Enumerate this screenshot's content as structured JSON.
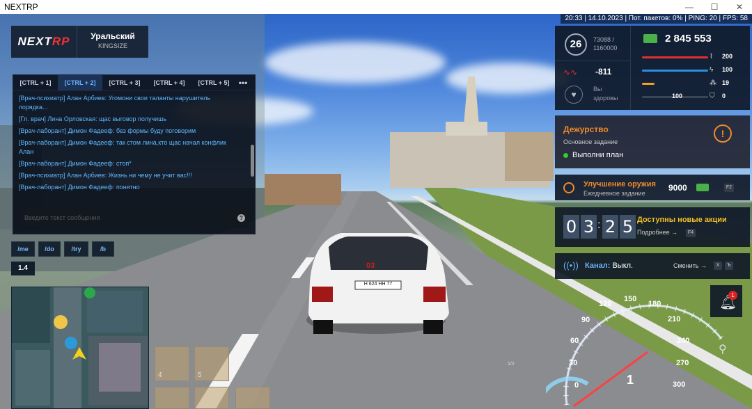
{
  "window": {
    "title": "NEXTRP",
    "min": "—",
    "max": "☐",
    "close": "✕"
  },
  "status": "20:33 | 14.10.2023 | Пот. пакетов: 0% | PING: 20 | FPS: 58",
  "logo": {
    "brand_a": "NEXT",
    "brand_b": "RP",
    "server": "Уральский",
    "sub": "KINGSIZE"
  },
  "chat": {
    "tabs": [
      "[CTRL + 1]",
      "[CTRL + 2]",
      "[CTRL + 3]",
      "[CTRL + 4]",
      "[CTRL + 5]",
      "•••"
    ],
    "messages": [
      "[Врач-психиатр] Алан Арбиев: Угомони свои таланты нарушитель порядка...",
      "[Гл. врач] Лина Орловская: щас выговор получишь",
      "[Врач-лаборант] Димон Фадееф: без формы буду поговорим",
      "[Врач-лаборант] Димон Фадееф: так стом лина,кто щас начал конфлик Алан",
      "[Врач-лаборант] Димон Фадееф: стоп*",
      "[Врач-психиатр] Алан Арбиев: Жизнь ни чему не учит вас!!!",
      "[Врач-лаборант] Димон Фадееф: понятно"
    ],
    "placeholder": "Введите текст сообщения",
    "help": "?"
  },
  "commands": [
    "/me",
    "/do",
    "/try",
    "/b"
  ],
  "version": "1.4",
  "slots": [
    "4",
    "5"
  ],
  "hud": {
    "level": "26",
    "xp_current": "73088 /",
    "xp_max": "1160000",
    "money": "2 845 553",
    "reputation": "-811",
    "health_label": "Вы",
    "health_value": "здоровы",
    "stats": [
      {
        "value": "200",
        "color": "#e03030",
        "fill": 1.0
      },
      {
        "value": "100",
        "color": "#2a8fe0",
        "fill": 1.0
      },
      {
        "value": "19",
        "color": "#f0a020",
        "fill": 0.19
      },
      {
        "value": "0",
        "color": "#ffffff",
        "fill": 0.0
      }
    ],
    "armor_value": "100"
  },
  "duty": {
    "title": "Дежурство",
    "subtitle": "Основное задание",
    "task": "Выполни план",
    "icon": "!"
  },
  "weapon_task": {
    "title": "Улучшение оружия",
    "subtitle": "Ежедневное задание",
    "reward": "9000",
    "key": "F2"
  },
  "promo": {
    "d1": "0",
    "d2": "3",
    "sep": ":",
    "d3": "2",
    "d4": "5",
    "title": "Доступны новые акции",
    "link": "Подробнее →",
    "key": "F4"
  },
  "channel": {
    "label": "Канал:",
    "value": "Выкл.",
    "change": "Сменить →",
    "k1": "X",
    "k2": "Ъ"
  },
  "notif": {
    "count": "1"
  },
  "speedo": {
    "ticks": [
      "0",
      "30",
      "60",
      "90",
      "120",
      "150",
      "180",
      "210",
      "240",
      "270",
      "300"
    ],
    "gear": "1",
    "half": "1/2"
  },
  "plate": {
    "text": "Н 624 НН 77",
    "roof": "03"
  }
}
